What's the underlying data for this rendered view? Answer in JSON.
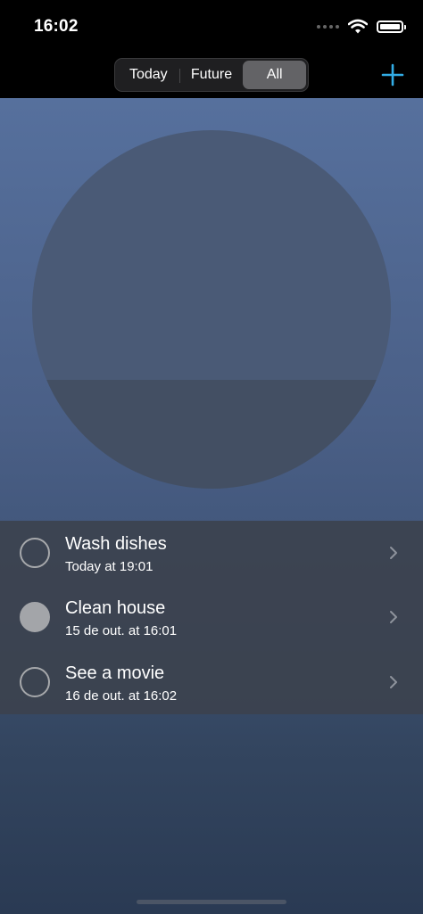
{
  "status_bar": {
    "time": "16:02",
    "icons": [
      "signal-dots-icon",
      "wifi-icon",
      "battery-icon"
    ]
  },
  "nav": {
    "segments": [
      {
        "label": "Today",
        "selected": false
      },
      {
        "label": "Future",
        "selected": false
      },
      {
        "label": "All",
        "selected": true
      }
    ],
    "add_icon": "plus-icon",
    "accent_color": "#32ade6"
  },
  "tasks": [
    {
      "title": "Wash dishes",
      "subtitle": "Today at 19:01",
      "completed": false
    },
    {
      "title": "Clean house",
      "subtitle": "15 de out. at 16:01",
      "completed": true
    },
    {
      "title": "See a movie",
      "subtitle": "16 de out. at 16:02",
      "completed": false
    }
  ]
}
